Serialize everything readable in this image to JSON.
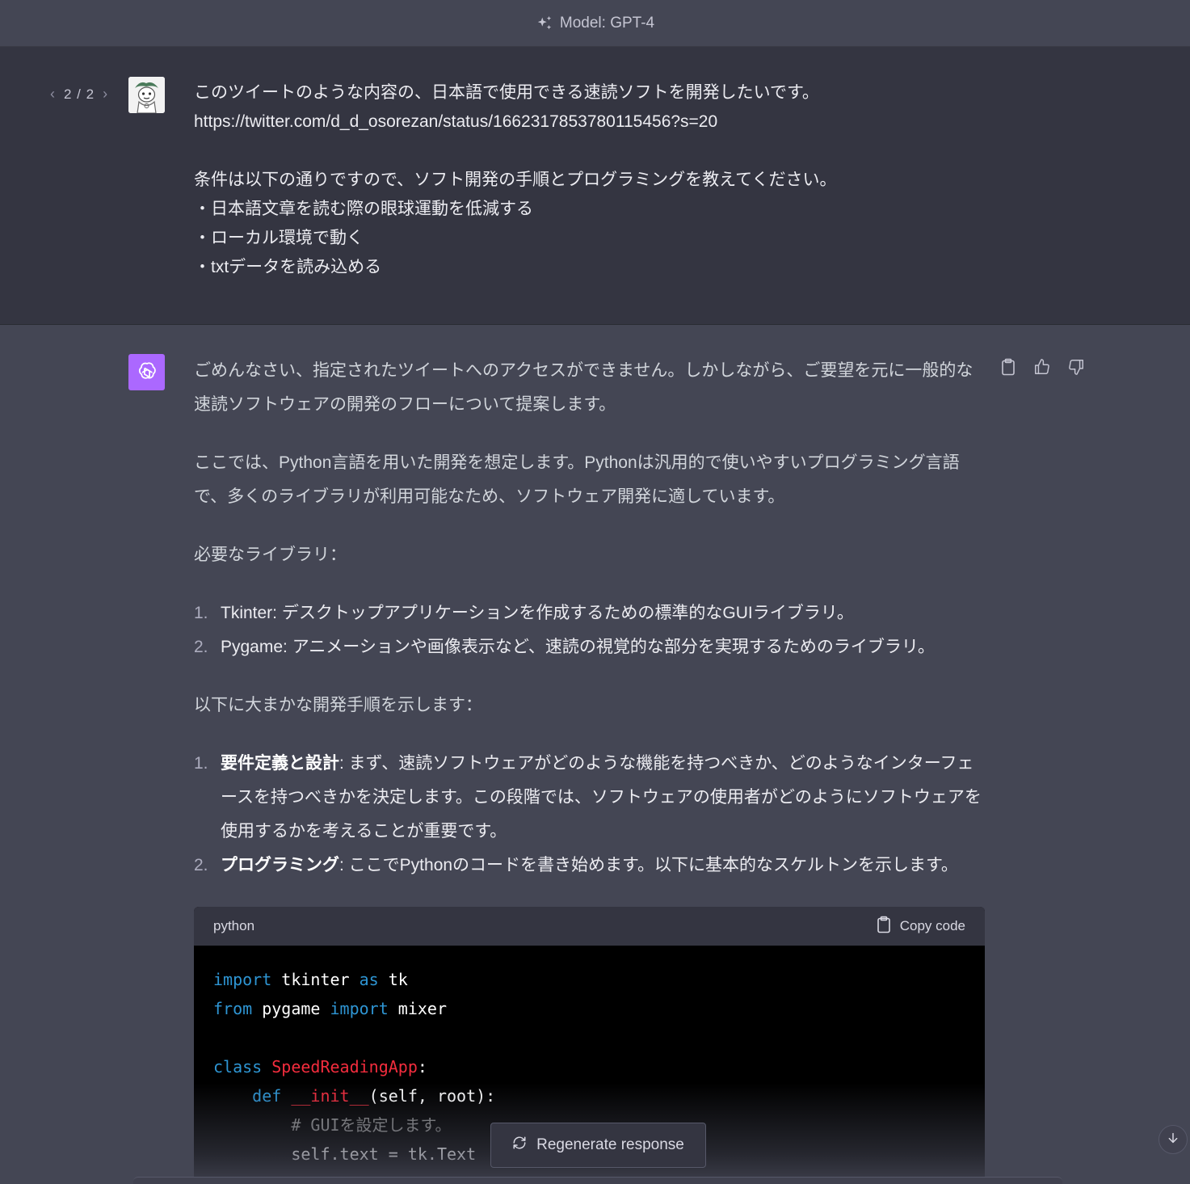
{
  "header": {
    "model_label": "Model: GPT-4"
  },
  "pager": {
    "label": "2 / 2",
    "prev_icon": "chevron-left",
    "next_icon": "chevron-right"
  },
  "user": {
    "lines": [
      "このツイートのような内容の、日本語で使用できる速読ソフトを開発したいです。",
      "https://twitter.com/d_d_osorezan/status/1662317853780115456?s=20",
      "",
      "条件は以下の通りですので、ソフト開発の手順とプログラミングを教えてください。",
      "・日本語文章を読む際の眼球運動を低減する",
      "・ローカル環境で動く",
      "・txtデータを読み込める"
    ]
  },
  "assistant": {
    "p1": "ごめんなさい、指定されたツイートへのアクセスができません。しかしながら、ご要望を元に一般的な速読ソフトウェアの開発のフローについて提案します。",
    "p2": "ここでは、Python言語を用いた開発を想定します。Pythonは汎用的で使いやすいプログラミング言語で、多くのライブラリが利用可能なため、ソフトウェア開発に適しています。",
    "p3": "必要なライブラリ：",
    "libs": [
      {
        "num": "1.",
        "text": "Tkinter: デスクトップアプリケーションを作成するための標準的なGUIライブラリ。"
      },
      {
        "num": "2.",
        "text": "Pygame: アニメーションや画像表示など、速読の視覚的な部分を実現するためのライブラリ。"
      }
    ],
    "p4": "以下に大まかな開発手順を示します：",
    "steps": [
      {
        "num": "1.",
        "title": "要件定義と設計",
        "text": ": まず、速読ソフトウェアがどのような機能を持つべきか、どのようなインターフェースを持つべきかを決定します。この段階では、ソフトウェアの使用者がどのようにソフトウェアを使用するかを考えることが重要です。"
      },
      {
        "num": "2.",
        "title": "プログラミング",
        "text": ": ここでPythonのコードを書き始めます。以下に基本的なスケルトンを示します。"
      }
    ]
  },
  "code": {
    "language": "python",
    "copy_label": "Copy code",
    "lines": {
      "l1_a": "import",
      "l1_b": " tkinter ",
      "l1_c": "as",
      "l1_d": " tk",
      "l2_a": "from",
      "l2_b": " pygame ",
      "l2_c": "import",
      "l2_d": " mixer",
      "l4_a": "class",
      "l4_b": " SpeedReadingApp",
      "l4_c": ":",
      "l5_a": "    def",
      "l5_b": " __init__",
      "l5_c": "(self, root):",
      "l6": "        # GUIを設定します。",
      "l7": "        self.text = tk.Text"
    }
  },
  "regenerate": {
    "label": "Regenerate response"
  },
  "colors": {
    "user_bg": "#343541",
    "assistant_bg": "#444654",
    "gpt_icon": "#ab68ff",
    "keyword": "#2e95d3",
    "class_name": "#f22c3d"
  }
}
